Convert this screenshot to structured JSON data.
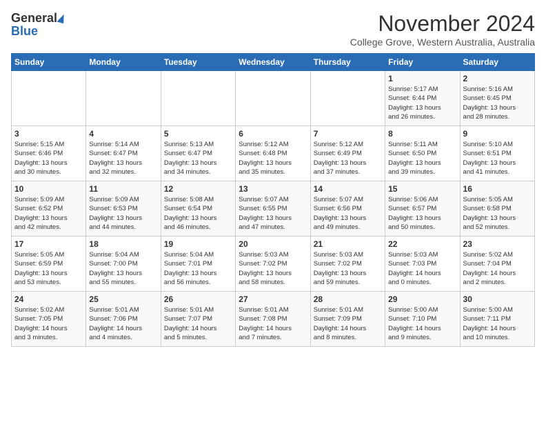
{
  "logo": {
    "general": "General",
    "blue": "Blue"
  },
  "title": "November 2024",
  "subtitle": "College Grove, Western Australia, Australia",
  "headers": [
    "Sunday",
    "Monday",
    "Tuesday",
    "Wednesday",
    "Thursday",
    "Friday",
    "Saturday"
  ],
  "weeks": [
    [
      {
        "day": "",
        "info": ""
      },
      {
        "day": "",
        "info": ""
      },
      {
        "day": "",
        "info": ""
      },
      {
        "day": "",
        "info": ""
      },
      {
        "day": "",
        "info": ""
      },
      {
        "day": "1",
        "info": "Sunrise: 5:17 AM\nSunset: 6:44 PM\nDaylight: 13 hours\nand 26 minutes."
      },
      {
        "day": "2",
        "info": "Sunrise: 5:16 AM\nSunset: 6:45 PM\nDaylight: 13 hours\nand 28 minutes."
      }
    ],
    [
      {
        "day": "3",
        "info": "Sunrise: 5:15 AM\nSunset: 6:46 PM\nDaylight: 13 hours\nand 30 minutes."
      },
      {
        "day": "4",
        "info": "Sunrise: 5:14 AM\nSunset: 6:47 PM\nDaylight: 13 hours\nand 32 minutes."
      },
      {
        "day": "5",
        "info": "Sunrise: 5:13 AM\nSunset: 6:47 PM\nDaylight: 13 hours\nand 34 minutes."
      },
      {
        "day": "6",
        "info": "Sunrise: 5:12 AM\nSunset: 6:48 PM\nDaylight: 13 hours\nand 35 minutes."
      },
      {
        "day": "7",
        "info": "Sunrise: 5:12 AM\nSunset: 6:49 PM\nDaylight: 13 hours\nand 37 minutes."
      },
      {
        "day": "8",
        "info": "Sunrise: 5:11 AM\nSunset: 6:50 PM\nDaylight: 13 hours\nand 39 minutes."
      },
      {
        "day": "9",
        "info": "Sunrise: 5:10 AM\nSunset: 6:51 PM\nDaylight: 13 hours\nand 41 minutes."
      }
    ],
    [
      {
        "day": "10",
        "info": "Sunrise: 5:09 AM\nSunset: 6:52 PM\nDaylight: 13 hours\nand 42 minutes."
      },
      {
        "day": "11",
        "info": "Sunrise: 5:09 AM\nSunset: 6:53 PM\nDaylight: 13 hours\nand 44 minutes."
      },
      {
        "day": "12",
        "info": "Sunrise: 5:08 AM\nSunset: 6:54 PM\nDaylight: 13 hours\nand 46 minutes."
      },
      {
        "day": "13",
        "info": "Sunrise: 5:07 AM\nSunset: 6:55 PM\nDaylight: 13 hours\nand 47 minutes."
      },
      {
        "day": "14",
        "info": "Sunrise: 5:07 AM\nSunset: 6:56 PM\nDaylight: 13 hours\nand 49 minutes."
      },
      {
        "day": "15",
        "info": "Sunrise: 5:06 AM\nSunset: 6:57 PM\nDaylight: 13 hours\nand 50 minutes."
      },
      {
        "day": "16",
        "info": "Sunrise: 5:05 AM\nSunset: 6:58 PM\nDaylight: 13 hours\nand 52 minutes."
      }
    ],
    [
      {
        "day": "17",
        "info": "Sunrise: 5:05 AM\nSunset: 6:59 PM\nDaylight: 13 hours\nand 53 minutes."
      },
      {
        "day": "18",
        "info": "Sunrise: 5:04 AM\nSunset: 7:00 PM\nDaylight: 13 hours\nand 55 minutes."
      },
      {
        "day": "19",
        "info": "Sunrise: 5:04 AM\nSunset: 7:01 PM\nDaylight: 13 hours\nand 56 minutes."
      },
      {
        "day": "20",
        "info": "Sunrise: 5:03 AM\nSunset: 7:02 PM\nDaylight: 13 hours\nand 58 minutes."
      },
      {
        "day": "21",
        "info": "Sunrise: 5:03 AM\nSunset: 7:02 PM\nDaylight: 13 hours\nand 59 minutes."
      },
      {
        "day": "22",
        "info": "Sunrise: 5:03 AM\nSunset: 7:03 PM\nDaylight: 14 hours\nand 0 minutes."
      },
      {
        "day": "23",
        "info": "Sunrise: 5:02 AM\nSunset: 7:04 PM\nDaylight: 14 hours\nand 2 minutes."
      }
    ],
    [
      {
        "day": "24",
        "info": "Sunrise: 5:02 AM\nSunset: 7:05 PM\nDaylight: 14 hours\nand 3 minutes."
      },
      {
        "day": "25",
        "info": "Sunrise: 5:01 AM\nSunset: 7:06 PM\nDaylight: 14 hours\nand 4 minutes."
      },
      {
        "day": "26",
        "info": "Sunrise: 5:01 AM\nSunset: 7:07 PM\nDaylight: 14 hours\nand 5 minutes."
      },
      {
        "day": "27",
        "info": "Sunrise: 5:01 AM\nSunset: 7:08 PM\nDaylight: 14 hours\nand 7 minutes."
      },
      {
        "day": "28",
        "info": "Sunrise: 5:01 AM\nSunset: 7:09 PM\nDaylight: 14 hours\nand 8 minutes."
      },
      {
        "day": "29",
        "info": "Sunrise: 5:00 AM\nSunset: 7:10 PM\nDaylight: 14 hours\nand 9 minutes."
      },
      {
        "day": "30",
        "info": "Sunrise: 5:00 AM\nSunset: 7:11 PM\nDaylight: 14 hours\nand 10 minutes."
      }
    ]
  ]
}
